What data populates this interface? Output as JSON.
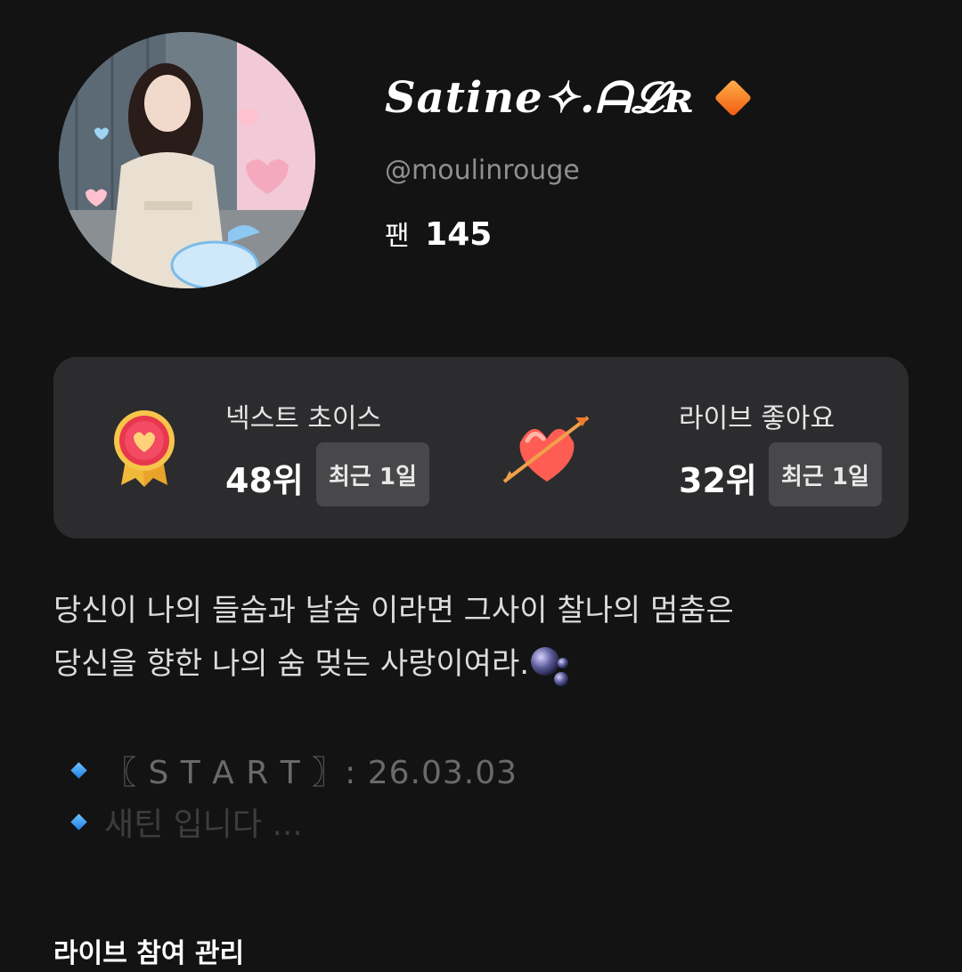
{
  "profile": {
    "display_name": "Satine✧.ᗩ𝓛ʀ",
    "badge_icon": "orange-diamond-icon",
    "handle": "@moulinrouge",
    "fans_label": "팬",
    "fans_count": "145",
    "avatar_icon": "profile-photo"
  },
  "rankings": [
    {
      "title": "넥스트 초이스",
      "rank": "48위",
      "period": "최근 1일",
      "icon": "medal-heart-icon"
    },
    {
      "title": "라이브 좋아요",
      "rank": "32위",
      "period": "최근 1일",
      "icon": "heart-arrow-icon"
    }
  ],
  "bio": {
    "line1": "당신이 나의 들숨과 날숨 이라면 그사이 찰나의 멈춤은",
    "line2": "당신을 향한 나의 숨 멎는 사랑이여라.",
    "emoji": "bubbles-icon"
  },
  "bullets": [
    {
      "text": "〖 S T A R T 〗: 26.03.03",
      "icon": "blue-diamond-icon"
    },
    {
      "text": "새틴 입니다 ...",
      "icon": "blue-diamond-icon"
    }
  ],
  "section": {
    "title": "라이브 참여 관리"
  },
  "colors": {
    "background": "#131313",
    "card": "#2c2c2e",
    "chip": "#48484a",
    "badge": "#f47a20",
    "bullet": "#3a9cf0"
  }
}
